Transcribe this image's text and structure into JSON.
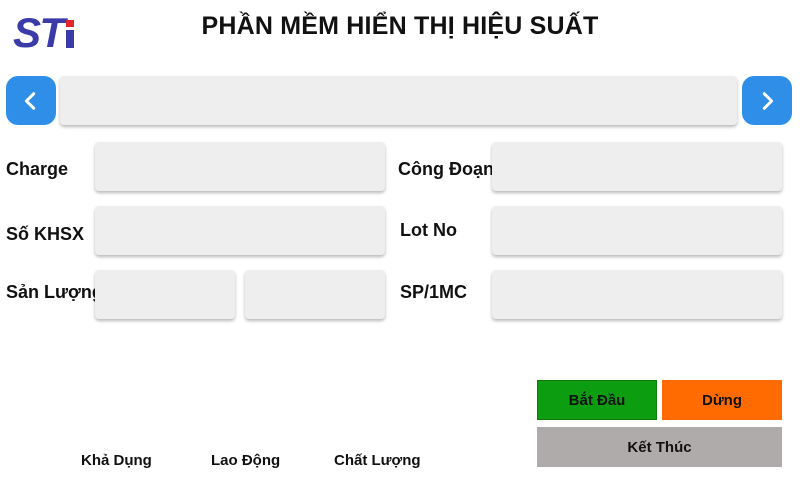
{
  "header": {
    "logo_text": "STi",
    "title": "PHẦN MỀM HIỂN THỊ HIỆU SUẤT"
  },
  "navigation": {
    "prev_icon": "chevron-left-icon",
    "next_icon": "chevron-right-icon",
    "display_value": ""
  },
  "form": {
    "charge_label": "Charge",
    "charge_value": "",
    "cong_doan_label": "Công Đoạn",
    "cong_doan_value": "",
    "so_khsx_label": "Số KHSX",
    "so_khsx_value": "",
    "lot_no_label": "Lot No",
    "lot_no_value": "",
    "san_luong_label": "Sản Lượng",
    "san_luong_value_1": "",
    "san_luong_value_2": "",
    "sp_1mc_label": "SP/1MC",
    "sp_1mc_value": ""
  },
  "actions": {
    "start_label": "Bắt Đầu",
    "stop_label": "Dừng",
    "end_label": "Kết Thúc"
  },
  "metrics": {
    "kha_dung": "Khả Dụng",
    "lao_dong": "Lao Động",
    "chat_luong": "Chất Lượng"
  },
  "colors": {
    "logo_blue": "#3a3aa8",
    "logo_red": "#e3242b",
    "nav_blue": "#2f8fe8",
    "field_bg": "#eeeeee",
    "start_green": "#0c9e10",
    "stop_orange": "#ff6b00",
    "end_gray": "#b0abab"
  }
}
